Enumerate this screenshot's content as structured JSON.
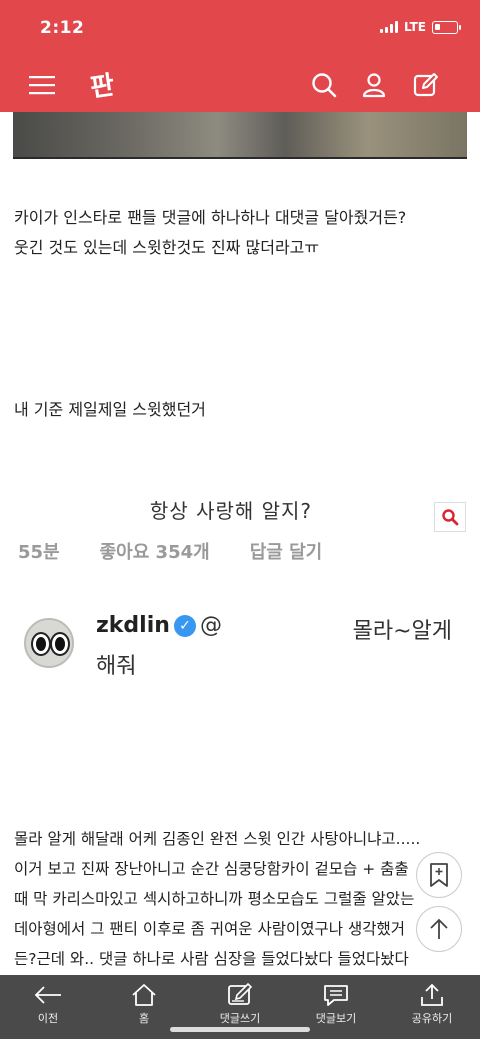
{
  "status": {
    "time": "2:12",
    "network": "LTE"
  },
  "header": {
    "logo_text": "판",
    "colors": {
      "brand": "#e2474c"
    }
  },
  "post": {
    "para1_line1": "카이가 인스타로 팬들 댓글에 하나하나 대댓글 달아줬거든?",
    "para1_line2": "웃긴 것도 있는데 스윗한것도 진짜 많더라고ㅠ",
    "para2": "내 기준 제일제일 스윗했던거",
    "instagram": {
      "caption": "항상 사랑해 알지?",
      "meta": [
        "55분",
        "좋아요 354개",
        "답글 달기"
      ],
      "username": "zkdlin",
      "verified_mark": "✓",
      "mention": "@",
      "reply_line1": "몰라~알게",
      "reply_line2": "해줘"
    },
    "para3": [
      "몰라 알게 해달래 어케 김종인 완전 스윗 인간 사탕아니냐고.....",
      "이거 보고 진짜 장난아니고 순간 심쿵당함카이 겉모습 + 춤출",
      "때 막 카리스마있고 섹시하고하니까 평소모습도 그럴줄 알았는",
      "데아형에서 그 팬티 이후로 좀 귀여운 사람이였구나 생각했거",
      "든?근데 와.. 댓글 하나로 사람 심장을 들었다놨다 들었다놨다"
    ]
  },
  "bottom_nav": [
    {
      "label": "이전",
      "icon": "back-arrow-icon"
    },
    {
      "label": "홈",
      "icon": "home-icon"
    },
    {
      "label": "댓글쓰기",
      "icon": "write-comment-icon"
    },
    {
      "label": "댓글보기",
      "icon": "view-comments-icon"
    },
    {
      "label": "공유하기",
      "icon": "share-icon"
    }
  ]
}
